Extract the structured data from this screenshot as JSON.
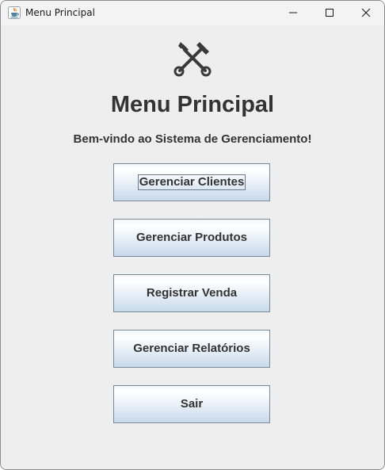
{
  "window": {
    "title": "Menu Principal",
    "app_icon": "java-cup-icon",
    "controls": {
      "minimize": "minimize-icon",
      "maximize": "maximize-icon",
      "close": "close-icon"
    }
  },
  "main": {
    "header_icon": "tools-icon",
    "title": "Menu Principal",
    "welcome": "Bem-vindo ao Sistema de Gerenciamento!",
    "buttons": [
      {
        "label": "Gerenciar Clientes",
        "focused": true
      },
      {
        "label": "Gerenciar Produtos",
        "focused": false
      },
      {
        "label": "Registrar Venda",
        "focused": false
      },
      {
        "label": "Gerenciar Relatórios",
        "focused": false
      },
      {
        "label": "Sair",
        "focused": false
      }
    ]
  },
  "colors": {
    "window_background": "#eeeeee",
    "text": "#333333",
    "button_border": "#7a8a99",
    "button_gradient_bottom": "#c8d9ea"
  }
}
